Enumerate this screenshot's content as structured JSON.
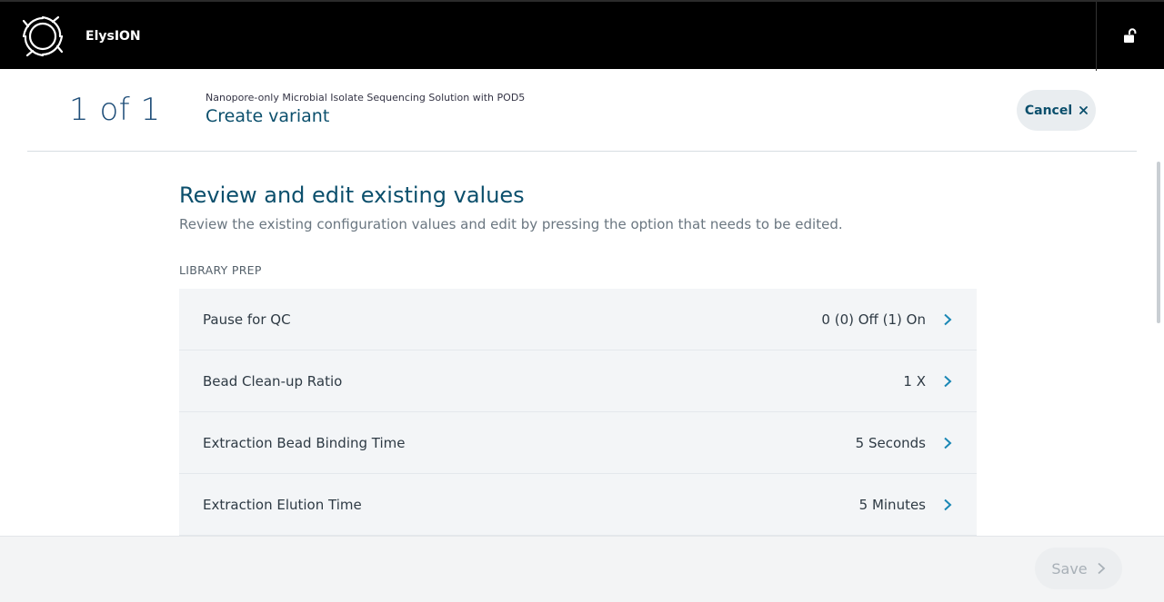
{
  "app": {
    "name": "ElysION"
  },
  "header": {
    "step": "1 of 1",
    "subtitle": "Nanopore-only Microbial Isolate Sequencing Solution with POD5",
    "title": "Create variant",
    "cancel_label": "Cancel"
  },
  "main": {
    "title": "Review and edit existing values",
    "description": "Review the existing configuration values and edit by pressing the option that needs to be edited.",
    "group_label": "LIBRARY PREP",
    "rows": [
      {
        "label": "Pause for QC",
        "value": "0 (0) Off (1) On"
      },
      {
        "label": "Bead Clean-up Ratio",
        "value": "1 X"
      },
      {
        "label": "Extraction Bead Binding Time",
        "value": "5 Seconds"
      },
      {
        "label": "Extraction Elution Time",
        "value": "5 Minutes"
      }
    ]
  },
  "footer": {
    "save_label": "Save"
  },
  "colors": {
    "accent": "#0b4f6c",
    "chevron": "#1a87b5",
    "topbar": "#000000"
  },
  "icons": [
    "logo-icon",
    "unlock-icon",
    "close-icon",
    "chevron-right-icon"
  ]
}
